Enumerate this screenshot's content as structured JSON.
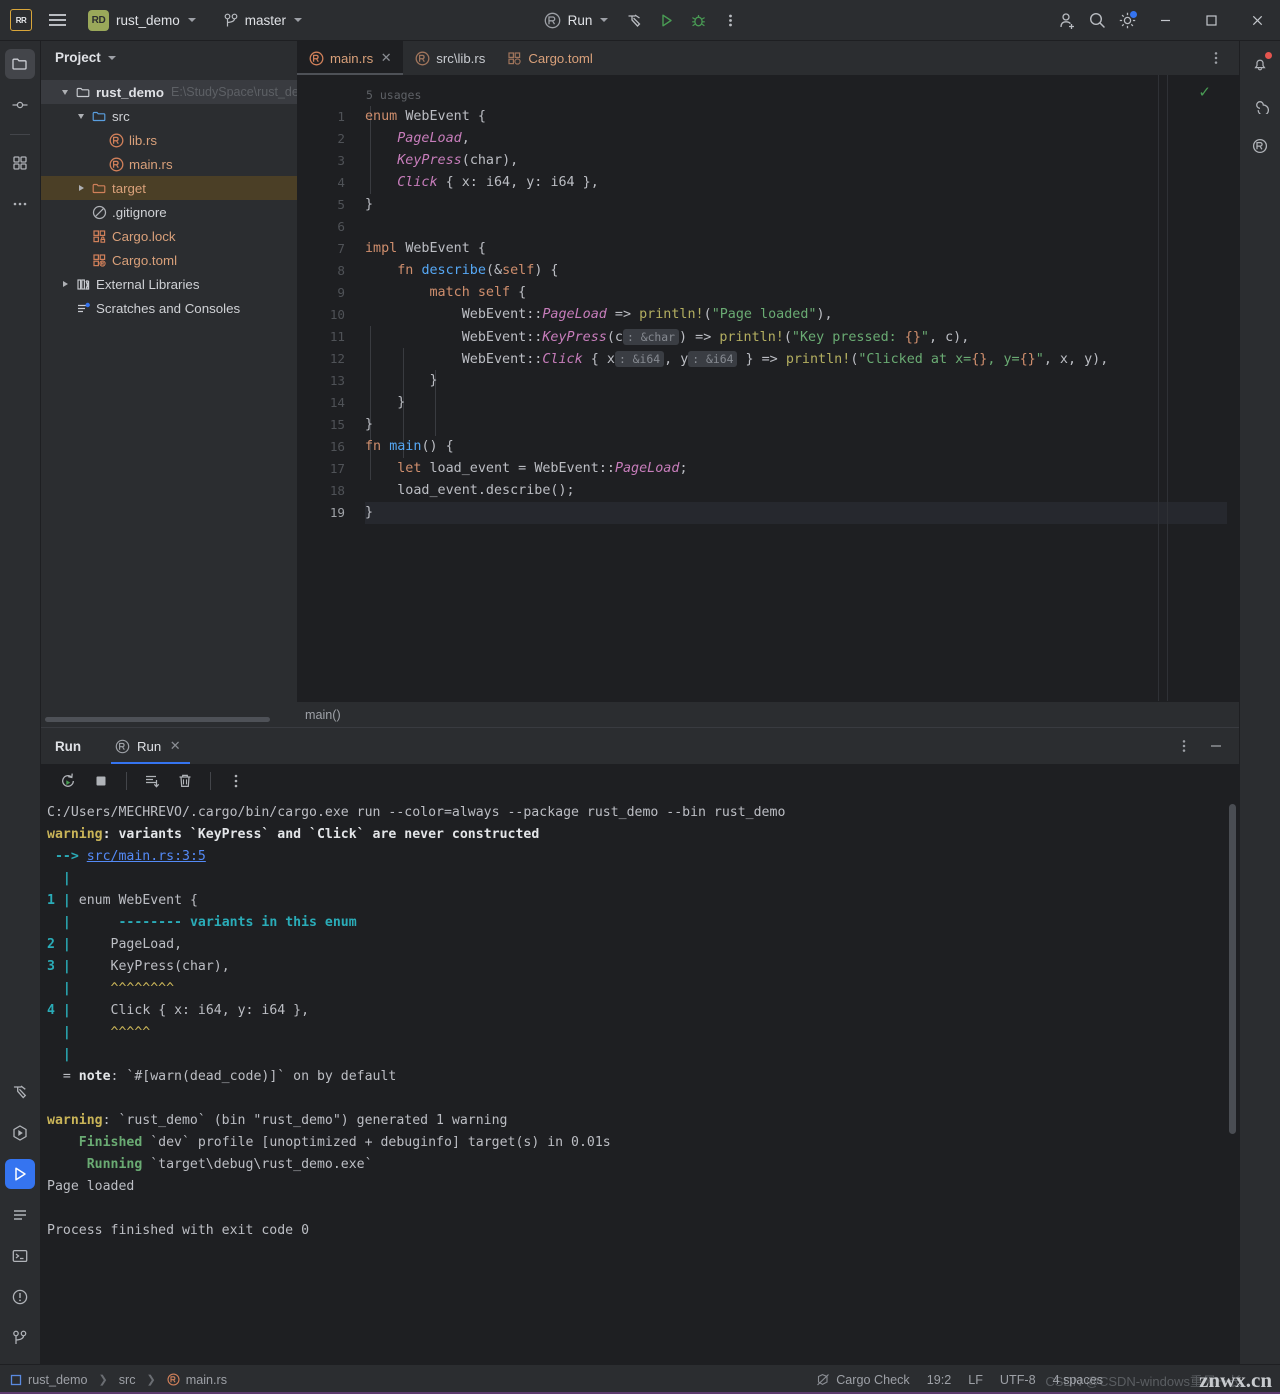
{
  "titlebar": {
    "logo_text": "RR",
    "project_badge": "RD",
    "project_name": "rust_demo",
    "branch_name": "master",
    "run_config_label": "Run",
    "icons": {
      "hamburger": "hamburger-menu-icon",
      "build": "hammer-build-icon",
      "run": "run-triangle-icon",
      "debug": "debug-bug-icon",
      "more": "more-vertical-icon",
      "account": "add-account-icon",
      "search": "search-icon",
      "settings": "gear-icon",
      "minimize": "minimize-icon",
      "maximize": "maximize-icon",
      "close": "close-icon"
    }
  },
  "left_stripe": {
    "items": [
      {
        "name": "project-tool-button",
        "icon": "folder-icon",
        "active": true
      },
      {
        "name": "commit-tool-button",
        "icon": "commit-node-icon",
        "active": false
      },
      {
        "name": "plugins-tool-button",
        "icon": "grid-squares-icon",
        "active": false
      },
      {
        "name": "more-tool-windows-button",
        "icon": "ellipsis-icon",
        "active": false
      }
    ],
    "bottom_items": [
      {
        "name": "build-tool-button",
        "icon": "hammer-icon",
        "active": false
      },
      {
        "name": "run-anything-button",
        "icon": "play-hexagon-icon",
        "active": false
      },
      {
        "name": "run-tool-button",
        "icon": "play-triangle-icon",
        "active": true
      },
      {
        "name": "todo-tool-button",
        "icon": "lines-icon",
        "active": false
      },
      {
        "name": "terminal-tool-button",
        "icon": "terminal-icon",
        "active": false
      },
      {
        "name": "problems-tool-button",
        "icon": "exclamation-circle-icon",
        "active": false
      },
      {
        "name": "version-control-button",
        "icon": "branch-icon",
        "active": false
      }
    ]
  },
  "right_stripe": {
    "items": [
      {
        "name": "notifications-button",
        "icon": "bell-icon",
        "badge": true
      },
      {
        "name": "ai-assistant-button",
        "icon": "spiral-icon",
        "badge": false
      },
      {
        "name": "rust-tool-button",
        "icon": "rust-gear-icon",
        "badge": false
      }
    ]
  },
  "project_panel": {
    "title": "Project",
    "tree": [
      {
        "label": "rust_demo",
        "path": "E:\\StudySpace\\rust_demo",
        "icon": "folder-icon",
        "depth": 0,
        "arrow": "down",
        "bold": true,
        "state": "selected-root"
      },
      {
        "label": "src",
        "icon": "folder-blue-icon",
        "depth": 1,
        "arrow": "down"
      },
      {
        "label": "lib.rs",
        "icon": "rust-file-icon",
        "depth": 2,
        "arrow": "none",
        "color": "rust"
      },
      {
        "label": "main.rs",
        "icon": "rust-file-icon",
        "depth": 2,
        "arrow": "none",
        "color": "rust"
      },
      {
        "label": "target",
        "icon": "folder-orange-icon",
        "depth": 1,
        "arrow": "right",
        "state": "highlighted",
        "color": "orange"
      },
      {
        "label": ".gitignore",
        "icon": "gitignore-icon",
        "depth": 1,
        "arrow": "none"
      },
      {
        "label": "Cargo.lock",
        "icon": "cargo-lock-icon",
        "depth": 1,
        "arrow": "none",
        "color": "rust"
      },
      {
        "label": "Cargo.toml",
        "icon": "cargo-toml-icon",
        "depth": 1,
        "arrow": "none",
        "color": "rust"
      },
      {
        "label": "External Libraries",
        "icon": "library-icon",
        "depth": 0,
        "arrow": "right"
      },
      {
        "label": "Scratches and Consoles",
        "icon": "scratches-icon",
        "depth": 0,
        "arrow": "none"
      }
    ]
  },
  "editor": {
    "tabs": [
      {
        "label": "main.rs",
        "icon": "rust-file-icon",
        "active": true,
        "closable": true
      },
      {
        "label": "src\\lib.rs",
        "icon": "rust-file-icon",
        "active": false,
        "closable": false
      },
      {
        "label": "Cargo.toml",
        "icon": "cargo-toml-icon",
        "active": false,
        "closable": false
      }
    ],
    "usages_hint": "5 usages",
    "breadcrumb": "main()",
    "inspection_status": "ok",
    "lines": [
      {
        "n": 1,
        "gutter": "implementations-icon"
      },
      {
        "n": 2
      },
      {
        "n": 3
      },
      {
        "n": 4
      },
      {
        "n": 5
      },
      {
        "n": 6
      },
      {
        "n": 7
      },
      {
        "n": 8
      },
      {
        "n": 9
      },
      {
        "n": 10
      },
      {
        "n": 11
      },
      {
        "n": 12
      },
      {
        "n": 13
      },
      {
        "n": 14
      },
      {
        "n": 15
      },
      {
        "n": 16,
        "gutter": "run-gutter-icon"
      },
      {
        "n": 17
      },
      {
        "n": 18,
        "gutter": "intention-bulb-icon"
      },
      {
        "n": 19,
        "current": true
      }
    ],
    "source_text": [
      "enum WebEvent {",
      "    PageLoad,",
      "    KeyPress(char),",
      "    Click { x: i64, y: i64 },",
      "}",
      "",
      "impl WebEvent {",
      "    fn describe(&self) {",
      "        match self {",
      "            WebEvent::PageLoad => println!(\"Page loaded\"),",
      "            WebEvent::KeyPress(c: &char) => println!(\"Key pressed: {}\", c),",
      "            WebEvent::Click { x: &i64, y: &i64 } => println!(\"Clicked at x={}, y={}\", x, y),",
      "        }",
      "    }",
      "}",
      "fn main() {",
      "    let load_event = WebEvent::PageLoad;",
      "    load_event.describe();",
      "}"
    ],
    "inlay_hints": [
      ": &char",
      ": &i64",
      ": &i64"
    ]
  },
  "run_window": {
    "title": "Run",
    "tab_label": "Run",
    "tab_icon": "rust-run-icon",
    "toolbar": [
      {
        "name": "rerun-button",
        "icon": "rerun-icon"
      },
      {
        "name": "stop-button",
        "icon": "stop-square-icon"
      },
      {
        "name": "scroll-to-end-button",
        "icon": "scroll-end-icon"
      },
      {
        "name": "clear-all-button",
        "icon": "trash-icon"
      },
      {
        "name": "run-options-button",
        "icon": "more-vertical-icon"
      }
    ],
    "header_buttons": [
      {
        "name": "run-settings-button",
        "icon": "more-vertical-icon"
      },
      {
        "name": "hide-run-window-button",
        "icon": "minimize-icon"
      }
    ],
    "console": [
      {
        "segments": [
          {
            "t": "C:/Users/MECHREVO/.cargo/bin/cargo.exe run --color=always --package rust_demo --bin rust_demo",
            "c": "white"
          }
        ]
      },
      {
        "segments": [
          {
            "t": "warning",
            "c": "warn"
          },
          {
            "t": ": ",
            "c": "bold"
          },
          {
            "t": "variants `KeyPress` and `Click` are never constructed",
            "c": "bold"
          }
        ]
      },
      {
        "segments": [
          {
            "t": " ",
            "c": "white"
          },
          {
            "t": "-->",
            "c": "cyan"
          },
          {
            "t": " ",
            "c": "white"
          },
          {
            "t": "src/main.rs:3:5",
            "c": "link"
          }
        ]
      },
      {
        "segments": [
          {
            "t": "  ",
            "c": "white"
          },
          {
            "t": "|",
            "c": "cyan"
          }
        ]
      },
      {
        "segments": [
          {
            "t": "1",
            "c": "cyan"
          },
          {
            "t": " ",
            "c": "white"
          },
          {
            "t": "|",
            "c": "cyan"
          },
          {
            "t": " enum WebEvent {",
            "c": "white"
          }
        ]
      },
      {
        "segments": [
          {
            "t": "  ",
            "c": "white"
          },
          {
            "t": "|",
            "c": "cyan"
          },
          {
            "t": "      ",
            "c": "white"
          },
          {
            "t": "-------- variants in this enum",
            "c": "cyan"
          }
        ]
      },
      {
        "segments": [
          {
            "t": "2",
            "c": "cyan"
          },
          {
            "t": " ",
            "c": "white"
          },
          {
            "t": "|",
            "c": "cyan"
          },
          {
            "t": "     PageLoad,",
            "c": "white"
          }
        ]
      },
      {
        "segments": [
          {
            "t": "3",
            "c": "cyan"
          },
          {
            "t": " ",
            "c": "white"
          },
          {
            "t": "|",
            "c": "cyan"
          },
          {
            "t": "     KeyPress(char),",
            "c": "white"
          }
        ]
      },
      {
        "segments": [
          {
            "t": "  ",
            "c": "white"
          },
          {
            "t": "|",
            "c": "cyan"
          },
          {
            "t": "     ^^^^^^^^",
            "c": "yellow"
          }
        ]
      },
      {
        "segments": [
          {
            "t": "4",
            "c": "cyan"
          },
          {
            "t": " ",
            "c": "white"
          },
          {
            "t": "|",
            "c": "cyan"
          },
          {
            "t": "     Click { x: i64, y: i64 },",
            "c": "white"
          }
        ]
      },
      {
        "segments": [
          {
            "t": "  ",
            "c": "white"
          },
          {
            "t": "|",
            "c": "cyan"
          },
          {
            "t": "     ^^^^^",
            "c": "yellow"
          }
        ]
      },
      {
        "segments": [
          {
            "t": "  ",
            "c": "white"
          },
          {
            "t": "|",
            "c": "cyan"
          }
        ]
      },
      {
        "segments": [
          {
            "t": "  = ",
            "c": "white"
          },
          {
            "t": "note",
            "c": "bold"
          },
          {
            "t": ": `#[warn(dead_code)]` on by default",
            "c": "white"
          }
        ]
      },
      {
        "segments": [
          {
            "t": "",
            "c": "white"
          }
        ]
      },
      {
        "segments": [
          {
            "t": "warning",
            "c": "warn"
          },
          {
            "t": ": `rust_demo` (bin \"rust_demo\") generated 1 warning",
            "c": "white"
          }
        ]
      },
      {
        "segments": [
          {
            "t": "    ",
            "c": "white"
          },
          {
            "t": "Finished",
            "c": "green"
          },
          {
            "t": " `dev` profile [unoptimized + debuginfo] target(s) in 0.01s",
            "c": "white"
          }
        ]
      },
      {
        "segments": [
          {
            "t": "     ",
            "c": "white"
          },
          {
            "t": "Running",
            "c": "green"
          },
          {
            "t": " `target\\debug\\rust_demo.exe`",
            "c": "white"
          }
        ]
      },
      {
        "segments": [
          {
            "t": "Page loaded",
            "c": "white"
          }
        ]
      },
      {
        "segments": [
          {
            "t": "",
            "c": "white"
          }
        ]
      },
      {
        "segments": [
          {
            "t": "Process finished with exit code 0",
            "c": "white"
          }
        ]
      }
    ]
  },
  "status_bar": {
    "breadcrumb": [
      {
        "label": "rust_demo",
        "icon": "module-icon"
      },
      {
        "label": "src",
        "icon": "none"
      },
      {
        "label": "main.rs",
        "icon": "rust-file-icon"
      }
    ],
    "right_items": [
      {
        "name": "cargo-check-status",
        "label": "Cargo Check",
        "icon": "cargo-check-off-icon"
      },
      {
        "name": "caret-position",
        "label": "19:2"
      },
      {
        "name": "line-separator",
        "label": "LF"
      },
      {
        "name": "file-encoding",
        "label": "UTF-8"
      },
      {
        "name": "indent-setting",
        "label": "4 spaces"
      }
    ],
    "watermark": "znwx.cn",
    "watermark_faint": "CSDN @CSDN-windows重另一长"
  },
  "colors": {
    "accent_blue": "#3574f0",
    "rust_orange": "#d9a07a",
    "keyword": "#cf8e6d",
    "string": "#6aab73",
    "enum_variant": "#c77dbb",
    "macro": "#b3ae60",
    "function": "#56a8f5",
    "number": "#2aacb8",
    "editor_bg": "#1e1f22",
    "panel_bg": "#2b2d30"
  }
}
